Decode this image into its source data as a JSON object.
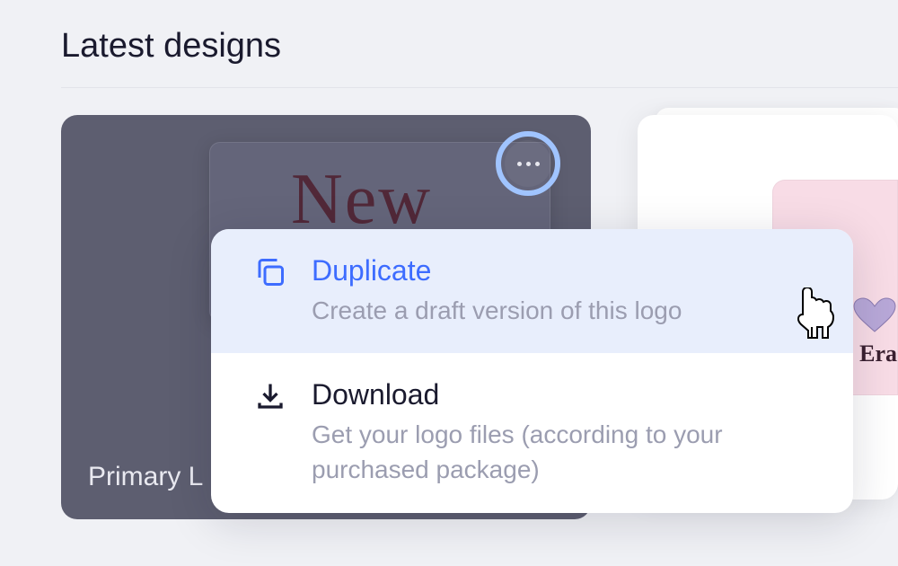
{
  "header": {
    "title": "Latest designs"
  },
  "cards": [
    {
      "label": "Primary L",
      "preview_text": "New"
    },
    {
      "preview_text": "Era"
    }
  ],
  "dropdown": {
    "items": [
      {
        "title": "Duplicate",
        "description": "Create a draft version of this logo"
      },
      {
        "title": "Download",
        "description": "Get your logo files (according to your purchased package)"
      }
    ]
  }
}
